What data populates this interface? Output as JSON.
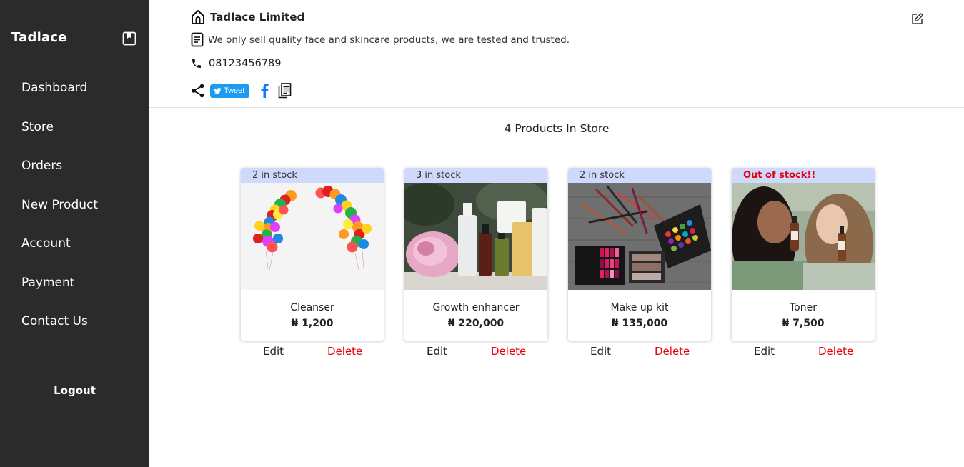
{
  "sidebar": {
    "brand": "Tadlace",
    "items": [
      {
        "label": "Dashboard"
      },
      {
        "label": "Store"
      },
      {
        "label": "Orders"
      },
      {
        "label": "New Product"
      },
      {
        "label": "Account"
      },
      {
        "label": "Payment"
      },
      {
        "label": "Contact Us"
      }
    ],
    "logout": "Logout"
  },
  "store": {
    "name": "Tadlace Limited",
    "description": "We only sell quality face and skincare products, we are tested and trusted.",
    "phone": "08123456789",
    "tweet_label": "Tweet"
  },
  "main": {
    "product_count": "4 Products In Store",
    "edit_label": "Edit",
    "delete_label": "Delete"
  },
  "products": [
    {
      "stock": "2 in stock",
      "name": "Cleanser",
      "price": "₦ 1,200"
    },
    {
      "stock": "3 in stock",
      "name": "Growth enhancer",
      "price": "₦ 220,000"
    },
    {
      "stock": "2 in stock",
      "name": "Make up kit",
      "price": "₦ 135,000"
    },
    {
      "stock": "Out of stock!!",
      "name": "Toner",
      "price": "₦ 7,500"
    }
  ],
  "colors": {
    "sidebar_bg": "#2b2b2b",
    "stock_band": "#cfd9fb",
    "danger": "#e8000f",
    "tweet_blue": "#1d9bf0",
    "facebook_blue": "#1877f2"
  }
}
